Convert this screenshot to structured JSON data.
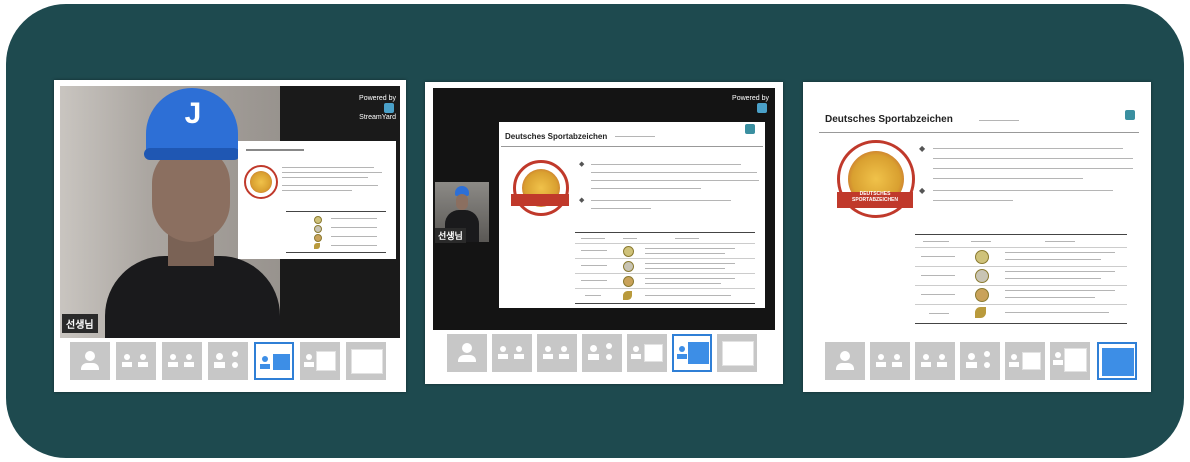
{
  "colors": {
    "background": "#1e4a4f",
    "selected": "#2f7fd6",
    "cap": "#2d6fd6"
  },
  "panels": [
    {
      "streamyard": {
        "powered": "Powered by",
        "brand": "StreamYard"
      },
      "name_tag": "선생님",
      "layouts_selected": 4
    },
    {
      "streamyard": {
        "powered": "Powered by"
      },
      "name_tag": "선생님",
      "slide": {
        "title": "Deutsches Sportabzeichen"
      },
      "layouts_selected": 5
    },
    {
      "slide": {
        "title": "Deutsches Sportabzeichen",
        "badge_text": "DEUTSCHES SPORTABZEICHEN"
      },
      "layouts_selected": 6
    }
  ],
  "layout_icons": [
    "solo-layout-icon",
    "two-up-layout-icon",
    "two-up-small-layout-icon",
    "grid-layout-icon",
    "picture-in-picture-layout-icon",
    "side-by-side-layout-icon",
    "screen-only-layout-icon"
  ]
}
